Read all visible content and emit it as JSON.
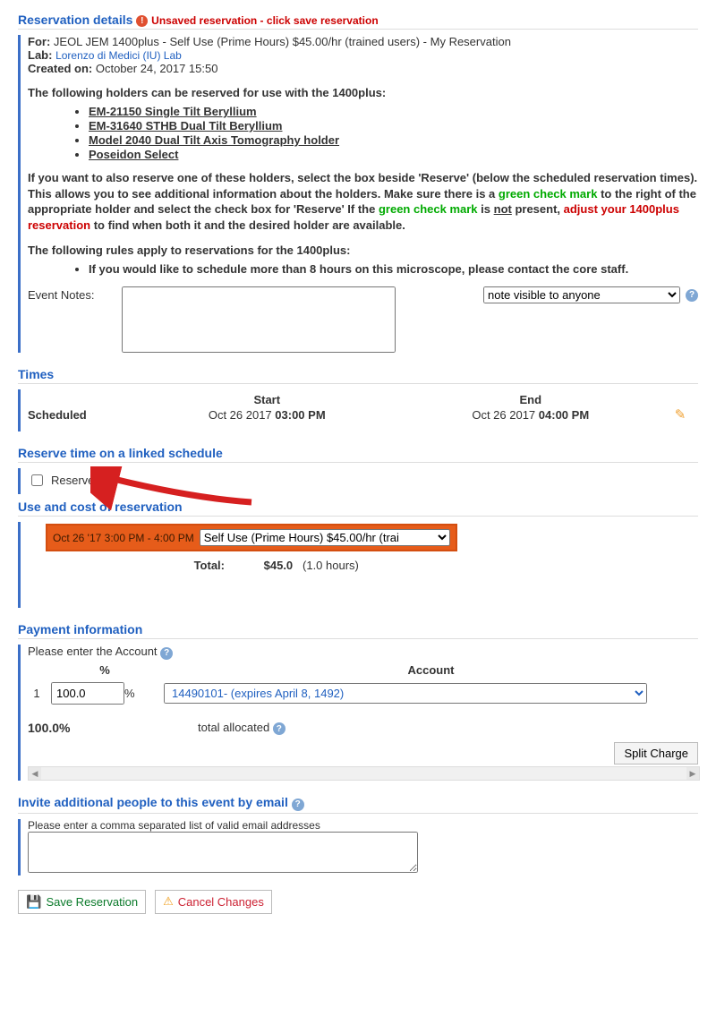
{
  "header": {
    "title": "Reservation details",
    "unsaved": "Unsaved reservation - click save reservation",
    "for_prefix": "For:",
    "for_text": " JEOL JEM 1400plus - Self Use (Prime Hours) $45.00/hr (trained users) - My Reservation",
    "lab_prefix": "Lab:",
    "lab_link": "Lorenzo di Medici (IU) Lab",
    "created_prefix": "Created on:",
    "created_text": " October 24, 2017 15:50"
  },
  "holders_intro": "The following holders can be reserved for use with the 1400plus:",
  "holders": [
    "EM-21150 Single Tilt Beryllium",
    "EM-31640 STHB Dual Tilt Beryllium",
    "Model 2040 Dual Tilt Axis Tomography holder",
    "Poseidon Select"
  ],
  "instructions": {
    "p1a": "If you want to also reserve one of these holders, select the box beside 'Reserve' (below the scheduled reservation times).  This allows you to see additional information about the holders.  Make sure there is a ",
    "green1": "green check mark",
    "p1b": " to the right of the appropriate holder and select the check box for 'Reserve'    If the ",
    "green2": "green check mark",
    "p1c": " is ",
    "not": "not",
    "p1d": " present, ",
    "adjust": "adjust your 1400plus reservation",
    "p1e": " to find when both it and the desired holder are available."
  },
  "rules_intro": "The following rules apply to reservations for the 1400plus:",
  "rules": [
    "If you would like to schedule more than 8 hours on this microscope, please contact the core staff."
  ],
  "event_notes_label": "Event Notes:",
  "note_visibility": {
    "selected": "note visible to anyone"
  },
  "times": {
    "title": "Times",
    "start_head": "Start",
    "end_head": "End",
    "row_label": "Scheduled",
    "start_date": "Oct 26 2017 ",
    "start_time": "03:00 PM",
    "end_date": "Oct 26 2017 ",
    "end_time": "04:00 PM"
  },
  "linked": {
    "title": "Reserve time on a linked schedule",
    "reserve_label": "Reserve"
  },
  "cost": {
    "title": "Use and cost of reservation",
    "time_range": "Oct 26 '17 3:00 PM - 4:00 PM",
    "select_value": "Self Use (Prime Hours) $45.00/hr (trai",
    "total_label": "Total:",
    "total_value": "$45.0",
    "total_hours": "(1.0 hours)"
  },
  "payment": {
    "title": "Payment information",
    "enter_account": "Please enter the Account",
    "pct_head": "%",
    "account_head": "Account",
    "row_index": "1",
    "pct_value": "100.0",
    "pct_suffix": "%",
    "account_value": "14490101- (expires April 8, 1492)",
    "allocated_pct": "100.0%",
    "allocated_label": "total allocated",
    "split_label": "Split Charge"
  },
  "invite": {
    "title": "Invite additional people to this event by email",
    "placeholder": "Please enter a comma separated list of valid email addresses"
  },
  "buttons": {
    "save": "Save Reservation",
    "cancel": "Cancel Changes"
  }
}
